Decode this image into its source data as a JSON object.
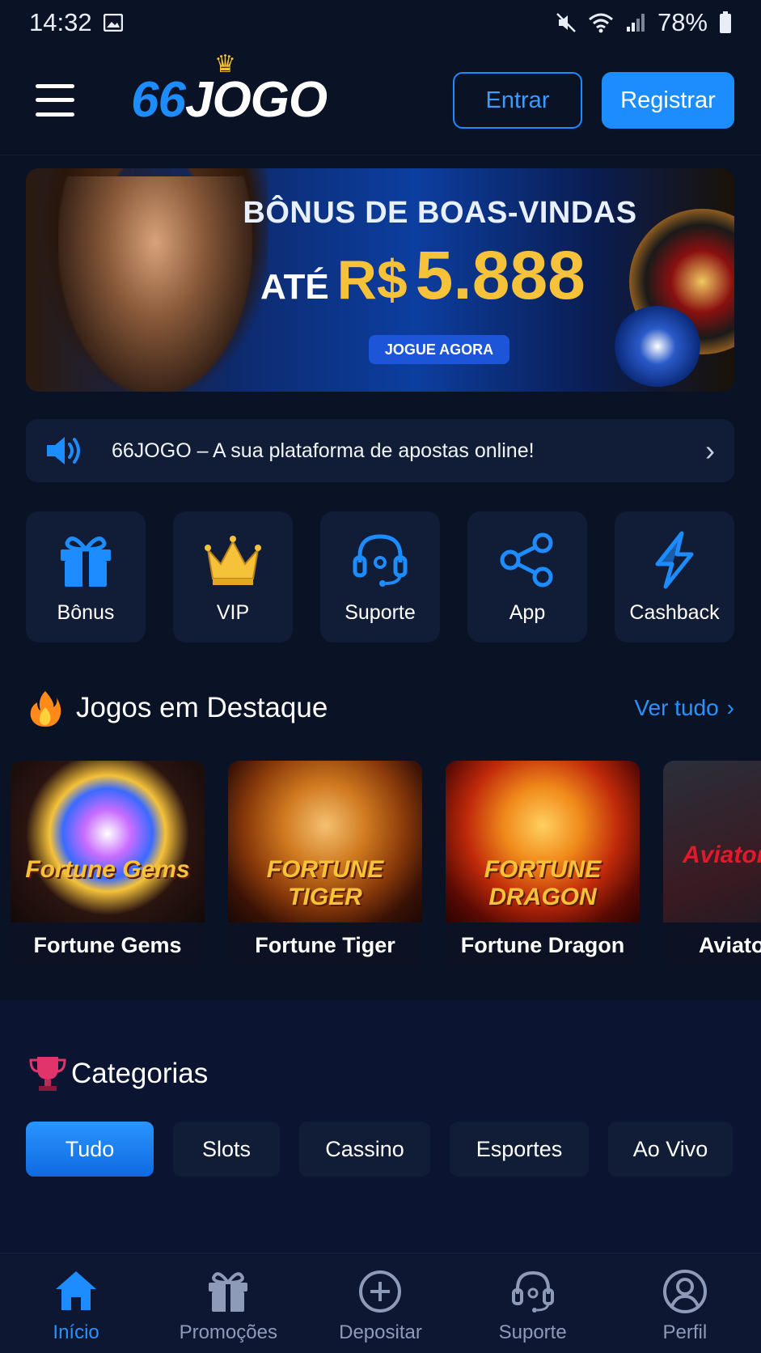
{
  "status_bar": {
    "time": "14:32",
    "battery": "78%",
    "icons": [
      "gallery-icon",
      "mute-icon",
      "wifi-icon",
      "signal-icon",
      "battery-icon"
    ]
  },
  "header": {
    "logo_number": "66",
    "logo_word": "JOGO",
    "login_label": "Entrar",
    "register_label": "Registrar"
  },
  "banner": {
    "title": "BÔNUS DE BOAS-VINDAS",
    "amount_prefix": "ATÉ",
    "currency": "R$",
    "amount": "5.888",
    "cta": "JOGUE AGORA"
  },
  "marquee": {
    "text": "66JOGO – A sua plataforma de apostas online!",
    "icon": "speaker-icon"
  },
  "quick_links": [
    {
      "label": "Bônus",
      "icon": "gift-icon"
    },
    {
      "label": "VIP",
      "icon": "crown-icon"
    },
    {
      "label": "Suporte",
      "icon": "headset-icon"
    },
    {
      "label": "App",
      "icon": "share-icon"
    },
    {
      "label": "Cashback",
      "icon": "lightning-icon"
    }
  ],
  "featured": {
    "title": "Jogos em Destaque",
    "see_all": "Ver tudo",
    "games": [
      {
        "name": "Fortune Gems",
        "art_text": "Fortune Gems"
      },
      {
        "name": "Fortune Tiger",
        "art_text": "FORTUNE TIGER"
      },
      {
        "name": "Fortune Dragon",
        "art_text": "FORTUNE DRAGON"
      },
      {
        "name": "Aviator",
        "art_text": "Aviator"
      }
    ]
  },
  "categories": {
    "title": "Categorias",
    "items": [
      {
        "label": "Tudo",
        "active": true
      },
      {
        "label": "Slots",
        "active": false
      },
      {
        "label": "Cassino",
        "active": false
      },
      {
        "label": "Esportes",
        "active": false
      },
      {
        "label": "Ao Vivo",
        "active": false
      }
    ]
  },
  "bottom_nav": [
    {
      "label": "Início",
      "icon": "home-icon",
      "active": true
    },
    {
      "label": "Promoções",
      "icon": "gift-icon",
      "active": false
    },
    {
      "label": "Depositar",
      "icon": "plus-circle-icon",
      "active": false
    },
    {
      "label": "Suporte",
      "icon": "headset-icon",
      "active": false
    },
    {
      "label": "Perfil",
      "icon": "user-icon",
      "active": false
    }
  ],
  "colors": {
    "accent": "#1d8cff",
    "background": "#0a1226",
    "card": "#111c36",
    "gold": "#f5c23a"
  }
}
